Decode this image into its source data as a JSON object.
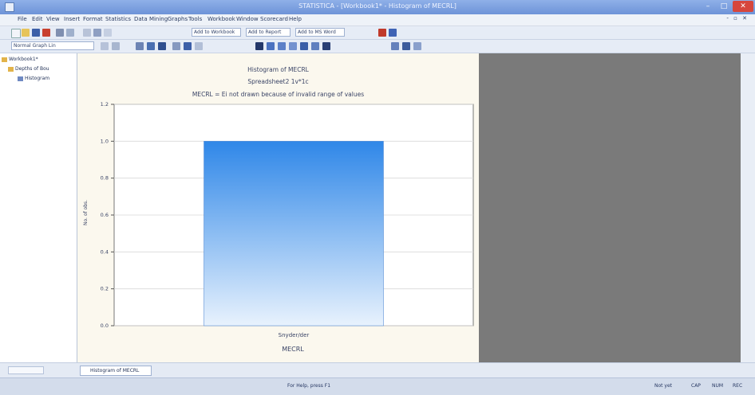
{
  "window": {
    "title": "STATISTICA - [Workbook1* - Histogram of MECRL]",
    "controls": {
      "minimize": "–",
      "maximize": "□",
      "close": "✕"
    }
  },
  "menu": [
    "File",
    "Edit",
    "View",
    "Insert",
    "Format",
    "Statistics",
    "Data Mining",
    "Graphs",
    "Tools",
    "Workbook",
    "Window",
    "Scorecard",
    "Help"
  ],
  "mdi_controls": "- ▫ ✕",
  "toolbar": {
    "combo_1": "Add to Workbook",
    "combo_2": "Add to Report",
    "combo_3": "Add to MS Word",
    "style_combo": "Normal Graph Lin"
  },
  "tree": {
    "root": "Workbook1*",
    "child": "Depths of Bou",
    "leaf": "Histogram"
  },
  "window_tab": "Histogram of MECRL",
  "status": {
    "help": "For Help, press F1",
    "field_1": "Not yet",
    "field_2": "CAP",
    "field_3": "NUM",
    "field_4": "REC"
  },
  "chart_data": {
    "type": "bar",
    "title": "Histogram of MECRL",
    "subtitle": "Spreadsheet2 1v*1c",
    "note": "MECRL = Ei not drawn because of invalid range of values",
    "categories": [
      "Snyder/der"
    ],
    "values": [
      1.0
    ],
    "xlabel": "MECRL",
    "ylabel": "No. of obs.",
    "ylim": [
      0,
      1.2
    ],
    "yticks": [
      "0.0",
      "0.2",
      "0.4",
      "0.6",
      "0.8",
      "1.0",
      "1.2"
    ],
    "grid": true,
    "bar_color": "#2f87e8"
  }
}
